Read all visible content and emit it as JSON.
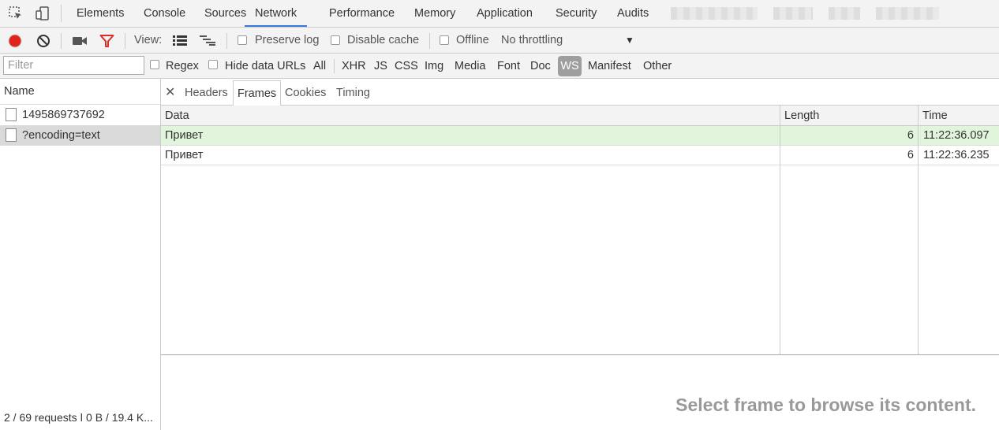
{
  "toptabs": [
    {
      "label": "Elements"
    },
    {
      "label": "Console"
    },
    {
      "label": "Sources"
    },
    {
      "label": "Network"
    },
    {
      "label": "Performance"
    },
    {
      "label": "Memory"
    },
    {
      "label": "Application"
    },
    {
      "label": "Security"
    },
    {
      "label": "Audits"
    }
  ],
  "active_toptab": "Network",
  "toolbar": {
    "view_label": "View:",
    "preserve_log": "Preserve log",
    "disable_cache": "Disable cache",
    "offline": "Offline",
    "throttling": "No throttling",
    "record_color": "#e0241c",
    "filter_icon_color": "#d93025"
  },
  "filter": {
    "placeholder": "Filter",
    "regex": "Regex",
    "hide_data_urls": "Hide data URLs",
    "types": [
      "All",
      "XHR",
      "JS",
      "CSS",
      "Img",
      "Media",
      "Font",
      "Doc",
      "WS",
      "Manifest",
      "Other"
    ],
    "active_type": "WS"
  },
  "requests": {
    "header": "Name",
    "items": [
      {
        "name": "1495869737692"
      },
      {
        "name": "?encoding=text"
      }
    ],
    "footer": "2 / 69 requests  ǀ  0 B / 19.4 K..."
  },
  "detail": {
    "tabs": [
      "Headers",
      "Frames",
      "Cookies",
      "Timing"
    ],
    "active_tab": "Frames",
    "columns": {
      "data": "Data",
      "length": "Length",
      "time": "Time"
    },
    "frames": [
      {
        "data": "Привет",
        "length": "6",
        "time": "11:22:36.097",
        "sent": true
      },
      {
        "data": "Привет",
        "length": "6",
        "time": "11:22:36.235",
        "sent": false
      }
    ],
    "empty_message": "Select frame to browse its content.",
    "sent_row_color": "#e1f5dc"
  }
}
